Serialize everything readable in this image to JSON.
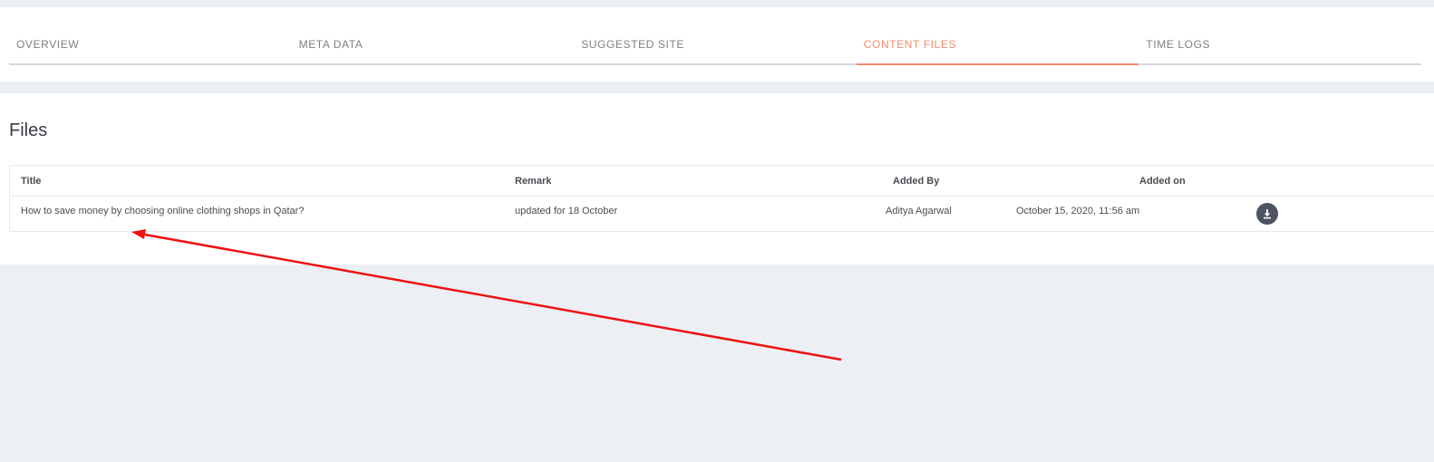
{
  "tabs": [
    {
      "label": "OVERVIEW",
      "active": false
    },
    {
      "label": "META DATA",
      "active": false
    },
    {
      "label": "SUGGESTED SITE",
      "active": false
    },
    {
      "label": "CONTENT FILES",
      "active": true
    },
    {
      "label": "TIME LOGS",
      "active": false
    }
  ],
  "files": {
    "title": "Files",
    "columns": {
      "title": "Title",
      "remark": "Remark",
      "added_by": "Added By",
      "added_on": "Added on"
    },
    "rows": [
      {
        "title": "How to save money by choosing online clothing shops in Qatar?",
        "remark": "updated for 18 October",
        "added_by": "Aditya Agarwal",
        "added_on": "October 15, 2020, 11:56 am",
        "action_icon": "download-icon"
      }
    ]
  },
  "colors": {
    "active_tab": "#f58a6c",
    "annotation_arrow": "#ee1111",
    "download_button": "#4c5363"
  }
}
